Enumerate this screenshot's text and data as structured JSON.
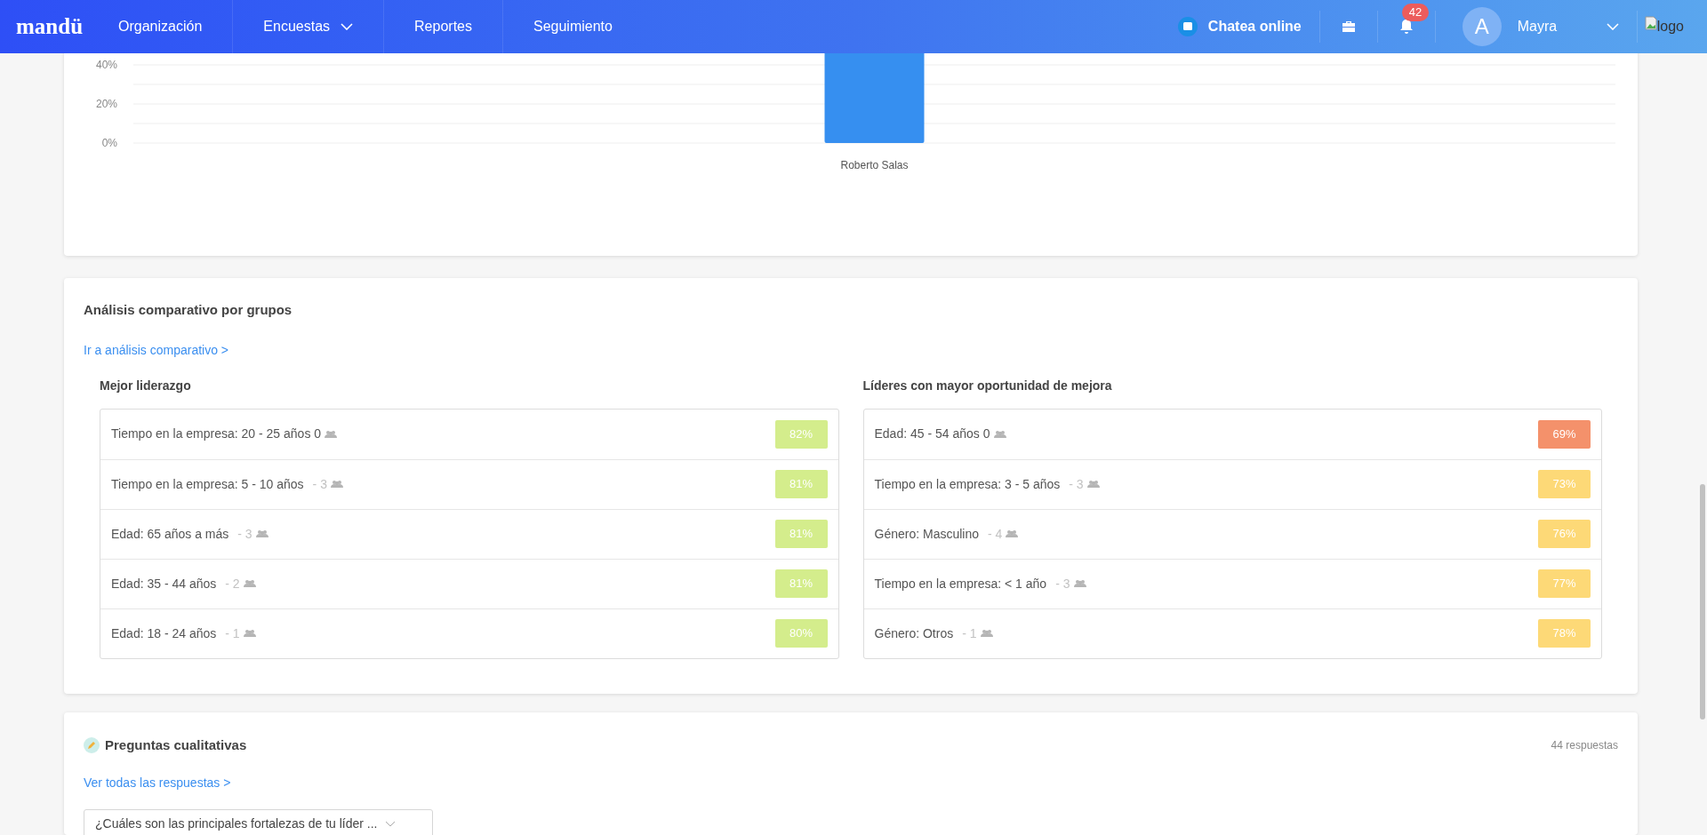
{
  "nav": {
    "logo": "mandü",
    "items": [
      {
        "label": "Organización",
        "dropdown": false
      },
      {
        "label": "Encuestas",
        "dropdown": true
      },
      {
        "label": "Reportes",
        "dropdown": false
      },
      {
        "label": "Seguimiento",
        "dropdown": false
      }
    ],
    "chat": "Chatea online",
    "notifications": "42",
    "avatar": "A",
    "user": "Mayra",
    "logo_alt": "logo"
  },
  "chart": {
    "yticks": [
      "40%",
      "20%",
      "0%"
    ],
    "categories": [
      "Roberto Salas"
    ]
  },
  "comparison": {
    "title": "Análisis comparativo por grupos",
    "link": "Ir a análisis comparativo >",
    "columns": [
      {
        "title": "Mejor liderazgo",
        "rows": [
          {
            "label": "Tiempo en la empresa: 20 - 25 años 0",
            "count": "",
            "value": "82%",
            "color": "#d4ed8c"
          },
          {
            "label": "Tiempo en la empresa: 5 - 10 años",
            "count": "- 3",
            "value": "81%",
            "color": "#d4ed8c"
          },
          {
            "label": "Edad: 65 años a más",
            "count": "- 3",
            "value": "81%",
            "color": "#d4ed8c"
          },
          {
            "label": "Edad: 35 - 44 años",
            "count": "- 2",
            "value": "81%",
            "color": "#d4ed8c"
          },
          {
            "label": "Edad: 18 - 24 años",
            "count": "- 1",
            "value": "80%",
            "color": "#d4ed8c"
          }
        ]
      },
      {
        "title": "Líderes con mayor oportunidad de mejora",
        "rows": [
          {
            "label": "Edad: 45 - 54 años 0",
            "count": "",
            "value": "69%",
            "color": "#f4916b"
          },
          {
            "label": "Tiempo en la empresa: 3 - 5 años",
            "count": "- 3",
            "value": "73%",
            "color": "#fdd977"
          },
          {
            "label": "Género: Masculino",
            "count": "- 4",
            "value": "76%",
            "color": "#fdd977"
          },
          {
            "label": "Tiempo en la empresa: < 1 año",
            "count": "- 3",
            "value": "77%",
            "color": "#fdd977"
          },
          {
            "label": "Género: Otros",
            "count": "- 1",
            "value": "78%",
            "color": "#fdd977"
          }
        ]
      }
    ]
  },
  "qualitative": {
    "title": "Preguntas cualitativas",
    "responses": "44 respuestas",
    "link": "Ver todas las respuestas >",
    "question": "¿Cuáles son las principales fortalezas de tu líder ..."
  }
}
